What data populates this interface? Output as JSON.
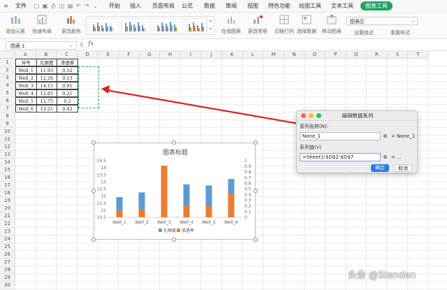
{
  "menubar": {
    "items": [
      "文件",
      "开始",
      "插入",
      "页面布局",
      "公式",
      "数据",
      "审阅",
      "视图",
      "特色功能",
      "绘图工具",
      "文本工具",
      "图表工具"
    ],
    "active": "图表工具"
  },
  "ribbon": {
    "buttons": [
      "添加元素",
      "快速布局",
      "更改颜色",
      "在线图表",
      "更改类型",
      "切换行列",
      "选择数据",
      "移动图表",
      "设置格式",
      "重置样式"
    ],
    "chart_area_select": "图表区"
  },
  "formula_bar": {
    "name_box": "图表 1",
    "fx": "fx"
  },
  "sheet": {
    "columns": [
      "A",
      "B",
      "C",
      "D",
      "E",
      "F",
      "G",
      "H",
      "I",
      "J",
      "K",
      "L",
      "M",
      "N",
      "O",
      "P",
      "Q",
      "R",
      "S",
      "T"
    ],
    "rows": [
      "1",
      "2",
      "3",
      "4",
      "5",
      "6",
      "7",
      "8",
      "9",
      "10",
      "11",
      "12",
      "13",
      "14",
      "15",
      "16",
      "17",
      "18",
      "19",
      "20",
      "21",
      "22",
      "23",
      "24",
      "25",
      "26",
      "27",
      "28",
      "29",
      "30"
    ],
    "headers": [
      "井号",
      "孔隙度",
      "渗透率"
    ],
    "table": [
      [
        "Well_1",
        "11.93",
        "0.12"
      ],
      [
        "Well_2",
        "12.26",
        "0.13"
      ],
      [
        "Well_3",
        "14.15",
        "0.91"
      ],
      [
        "Well_4",
        "12.83",
        "0.21"
      ],
      [
        "Well_5",
        "12.75",
        "0.2"
      ],
      [
        "Well_6",
        "13.21",
        "0.42"
      ]
    ]
  },
  "chart_data": {
    "type": "bar",
    "title": "图表标题",
    "categories": [
      "Well_1",
      "Well_2",
      "Well_3",
      "Well_4",
      "Well_5",
      "Well_6"
    ],
    "series": [
      {
        "name": "孔隙度",
        "axis": "left",
        "values": [
          11.93,
          12.26,
          14.15,
          12.83,
          12.75,
          13.21
        ],
        "color": "#5b9bd5"
      },
      {
        "name": "渗透率",
        "axis": "right",
        "values": [
          0.12,
          0.13,
          0.91,
          0.21,
          0.2,
          0.42
        ],
        "color": "#ed7d31"
      }
    ],
    "y_left": {
      "min": 10.5,
      "max": 14.5,
      "ticks": [
        "10.5",
        "11",
        "11.5",
        "12",
        "12.5",
        "13",
        "13.5",
        "14",
        "14.5"
      ]
    },
    "y_right": {
      "min": 0,
      "max": 1,
      "ticks": [
        "0",
        "0.1",
        "0.2",
        "0.3",
        "0.4",
        "0.5",
        "0.6",
        "0.7",
        "0.8",
        "0.9",
        "1"
      ]
    },
    "legend": "bottom",
    "grid": false
  },
  "dialog": {
    "title": "编辑数据系列",
    "name_label": "系列名称(N):",
    "name_value": "None_1",
    "name_eq": "= None_1",
    "values_label": "系列值(V)",
    "values_value": "=Sheet1!$D$2:$D$7",
    "values_eq": "= ...",
    "ok": "确定",
    "cancel": "取消"
  },
  "colors": {
    "accent": "#21a366",
    "arrow": "#e02020",
    "ok": "#2d7be0"
  },
  "watermark": "头条 @Stenden"
}
